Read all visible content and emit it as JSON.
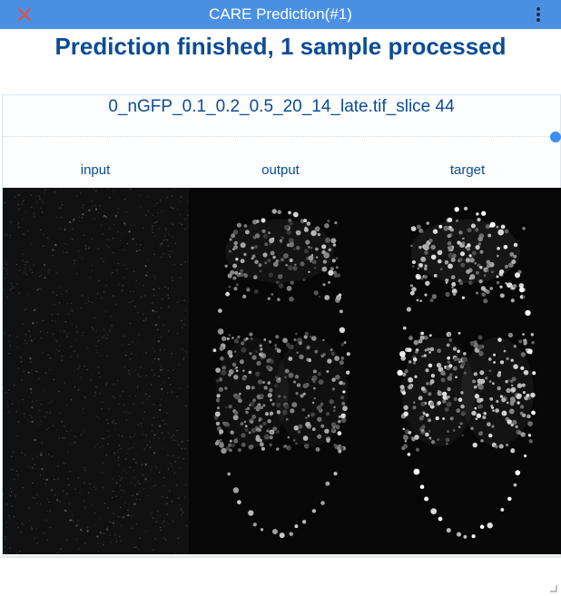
{
  "window": {
    "title": "CARE Prediction(#1)"
  },
  "main": {
    "heading": "Prediction finished, 1 sample processed",
    "file_title": "0_nGFP_0.1_0.2_0.5_20_14_late.tif_slice 44",
    "columns": [
      {
        "label": "input"
      },
      {
        "label": "output"
      },
      {
        "label": "target"
      }
    ],
    "slider_position": 1.0
  },
  "icons": {
    "close": "close-icon",
    "menu": "vertical-dots-menu-icon",
    "resize": "resize-grip-icon"
  },
  "colors": {
    "titlebar": "#4a90e2",
    "close_icon": "#e0504a",
    "heading_text": "#0b4c96",
    "slider_handle": "#3d8ef0",
    "image_background": "#0a0a0a"
  }
}
